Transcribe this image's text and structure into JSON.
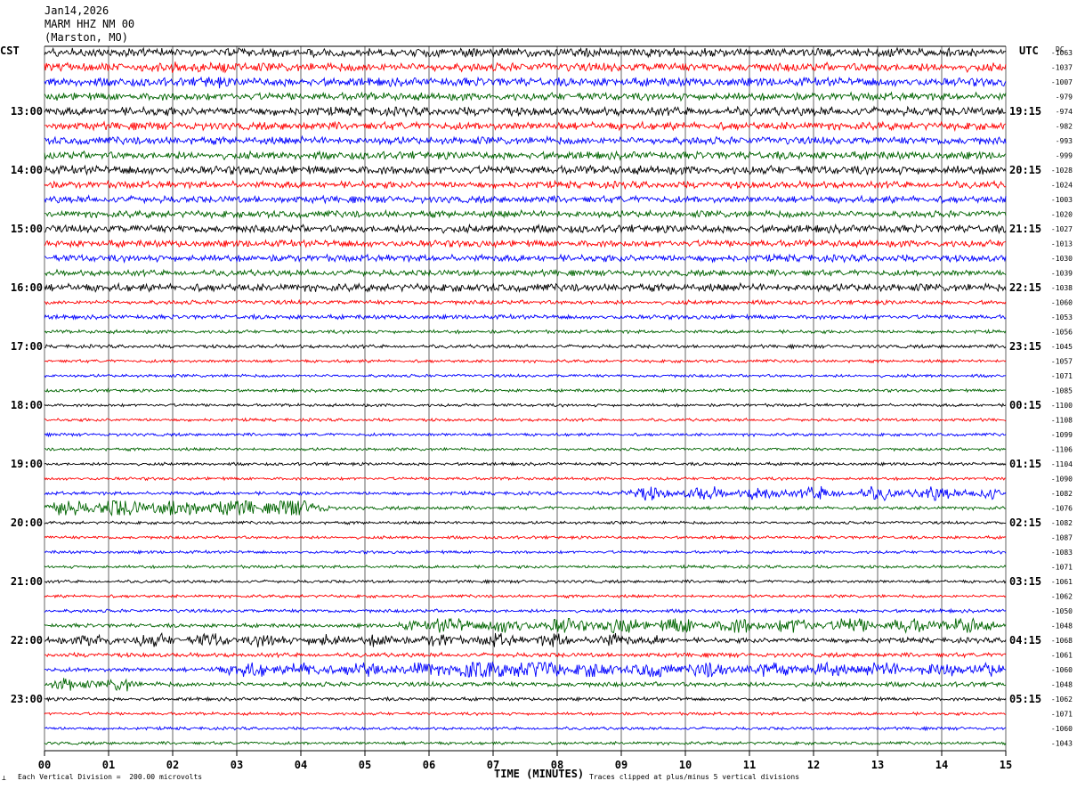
{
  "header": {
    "date": "Jan14,2026",
    "station": "MARM HHZ NM 00",
    "location": "(Marston, MO)",
    "left_zone": "CST",
    "right_zone": "UTC",
    "dc_label": "DC"
  },
  "footer": {
    "scale_note": "Each Vertical Division =  200.00 microvolts",
    "clip_note": "Traces clipped at plus/minus 5 vertical divisions"
  },
  "chart_data": {
    "type": "line",
    "xlabel": "TIME (MINUTES)",
    "xlim": [
      0,
      15
    ],
    "x_ticks": [
      "00",
      "01",
      "02",
      "03",
      "04",
      "05",
      "06",
      "07",
      "08",
      "09",
      "10",
      "11",
      "12",
      "13",
      "14",
      "15"
    ],
    "trace_colors": [
      "#000000",
      "#ff0000",
      "#0000ff",
      "#006400"
    ],
    "left_hour_labels": [
      {
        "row": 4,
        "label": "13:00"
      },
      {
        "row": 8,
        "label": "14:00"
      },
      {
        "row": 12,
        "label": "15:00"
      },
      {
        "row": 16,
        "label": "16:00"
      },
      {
        "row": 20,
        "label": "17:00"
      },
      {
        "row": 24,
        "label": "18:00"
      },
      {
        "row": 28,
        "label": "19:00"
      },
      {
        "row": 32,
        "label": "20:00"
      },
      {
        "row": 36,
        "label": "21:00"
      },
      {
        "row": 40,
        "label": "22:00"
      },
      {
        "row": 44,
        "label": "23:00"
      }
    ],
    "right_hour_labels": [
      {
        "row": 4,
        "label": "19:15"
      },
      {
        "row": 8,
        "label": "20:15"
      },
      {
        "row": 12,
        "label": "21:15"
      },
      {
        "row": 16,
        "label": "22:15"
      },
      {
        "row": 20,
        "label": "23:15"
      },
      {
        "row": 24,
        "label": "00:15"
      },
      {
        "row": 28,
        "label": "01:15"
      },
      {
        "row": 32,
        "label": "02:15"
      },
      {
        "row": 36,
        "label": "03:15"
      },
      {
        "row": 40,
        "label": "04:15"
      },
      {
        "row": 44,
        "label": "05:15"
      }
    ],
    "dc_offsets": [
      -1063,
      -1037,
      -1007,
      -979,
      -974,
      -982,
      -993,
      -999,
      -1028,
      -1024,
      -1003,
      -1020,
      -1027,
      -1013,
      -1030,
      -1039,
      -1038,
      -1060,
      -1053,
      -1056,
      -1045,
      -1057,
      -1071,
      -1085,
      -1100,
      -1108,
      -1099,
      -1106,
      -1104,
      -1090,
      -1082,
      -1076,
      -1082,
      -1087,
      -1083,
      -1071,
      -1061,
      -1062,
      -1050,
      -1048,
      -1068,
      -1061,
      -1060,
      -1048,
      -1062,
      -1071,
      -1060,
      -1043
    ],
    "row_amplitude": [
      1.0,
      1.0,
      1.0,
      0.9,
      1.0,
      0.9,
      0.9,
      0.9,
      1.0,
      0.8,
      0.8,
      0.8,
      0.9,
      0.8,
      0.8,
      0.7,
      0.9,
      0.5,
      0.5,
      0.4,
      0.4,
      0.35,
      0.35,
      0.35,
      0.35,
      0.35,
      0.35,
      0.35,
      0.35,
      0.35,
      0.4,
      0.4,
      0.35,
      0.35,
      0.35,
      0.35,
      0.35,
      0.35,
      0.4,
      0.45,
      0.6,
      0.5,
      0.5,
      0.55,
      0.4,
      0.35,
      0.35,
      0.35
    ],
    "bursts": [
      {
        "row": 1,
        "start": 1.8,
        "end": 3.0,
        "amp": 1.6
      },
      {
        "row": 2,
        "start": 1.8,
        "end": 3.0,
        "amp": 1.6
      },
      {
        "row": 30,
        "start": 8.8,
        "end": 15.0,
        "amp": 1.8
      },
      {
        "row": 31,
        "start": 0.0,
        "end": 4.5,
        "amp": 2.8
      },
      {
        "row": 39,
        "start": 5.5,
        "end": 15.0,
        "amp": 2.2
      },
      {
        "row": 40,
        "start": 0.0,
        "end": 9.8,
        "amp": 1.8
      },
      {
        "row": 42,
        "start": 2.5,
        "end": 15.0,
        "amp": 2.2
      },
      {
        "row": 42,
        "start": 6.2,
        "end": 8.2,
        "amp": 4.0
      },
      {
        "row": 43,
        "start": 0.0,
        "end": 1.5,
        "amp": 1.8
      }
    ]
  }
}
